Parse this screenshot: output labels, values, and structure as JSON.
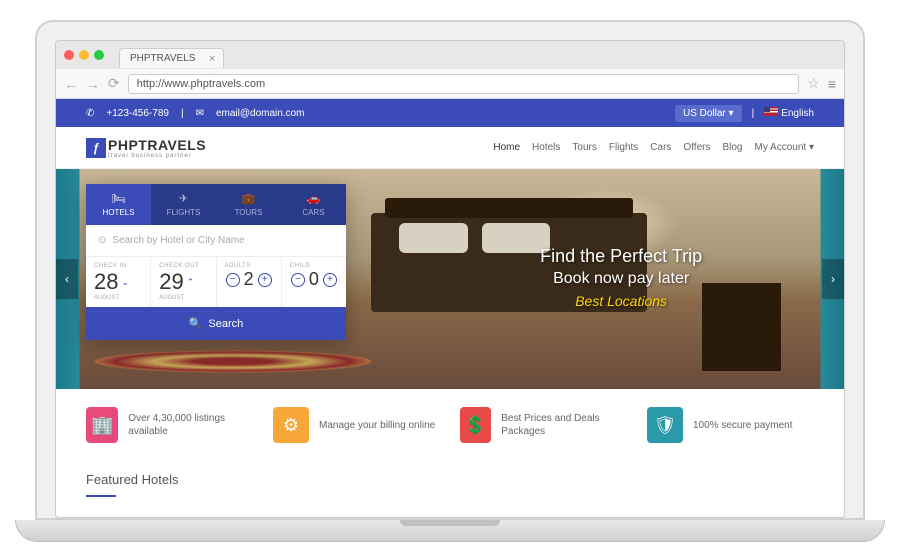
{
  "browser": {
    "tab_title": "PHPTRAVELS",
    "url": "http://www.phptravels.com"
  },
  "topbar": {
    "phone": "+123-456-789",
    "email": "email@domain.com",
    "currency": "US Dollar",
    "language": "English"
  },
  "brand": {
    "name": "PHPTRAVELS",
    "tagline": "travel business partner"
  },
  "nav": {
    "items": [
      "Home",
      "Hotels",
      "Tours",
      "Flights",
      "Cars",
      "Offers",
      "Blog",
      "My Account"
    ]
  },
  "hero": {
    "line1": "Find the Perfect Trip",
    "line2": "Book now pay later",
    "line3": "Best Locations"
  },
  "search": {
    "tabs": [
      {
        "label": "HOTELS",
        "icon": "🛏"
      },
      {
        "label": "FLIGHTS",
        "icon": "✈"
      },
      {
        "label": "TOURS",
        "icon": "💼"
      },
      {
        "label": "CARS",
        "icon": "🚗"
      }
    ],
    "placeholder": "Search by Hotel or City Name",
    "checkin": {
      "label": "CHECK IN",
      "day": "28",
      "month": "AUGUST"
    },
    "checkout": {
      "label": "CHECK OUT",
      "day": "29",
      "month": "AUGUST"
    },
    "adults": {
      "label": "ADULTS",
      "value": "2"
    },
    "child": {
      "label": "CHILD",
      "value": "0"
    },
    "button": "Search"
  },
  "features": [
    {
      "text": "Over 4,30,000 listings available"
    },
    {
      "text": "Manage your billing online"
    },
    {
      "text": "Best Prices and Deals Packages"
    },
    {
      "text": "100% secure payment"
    }
  ],
  "section": {
    "title": "Featured Hotels"
  }
}
